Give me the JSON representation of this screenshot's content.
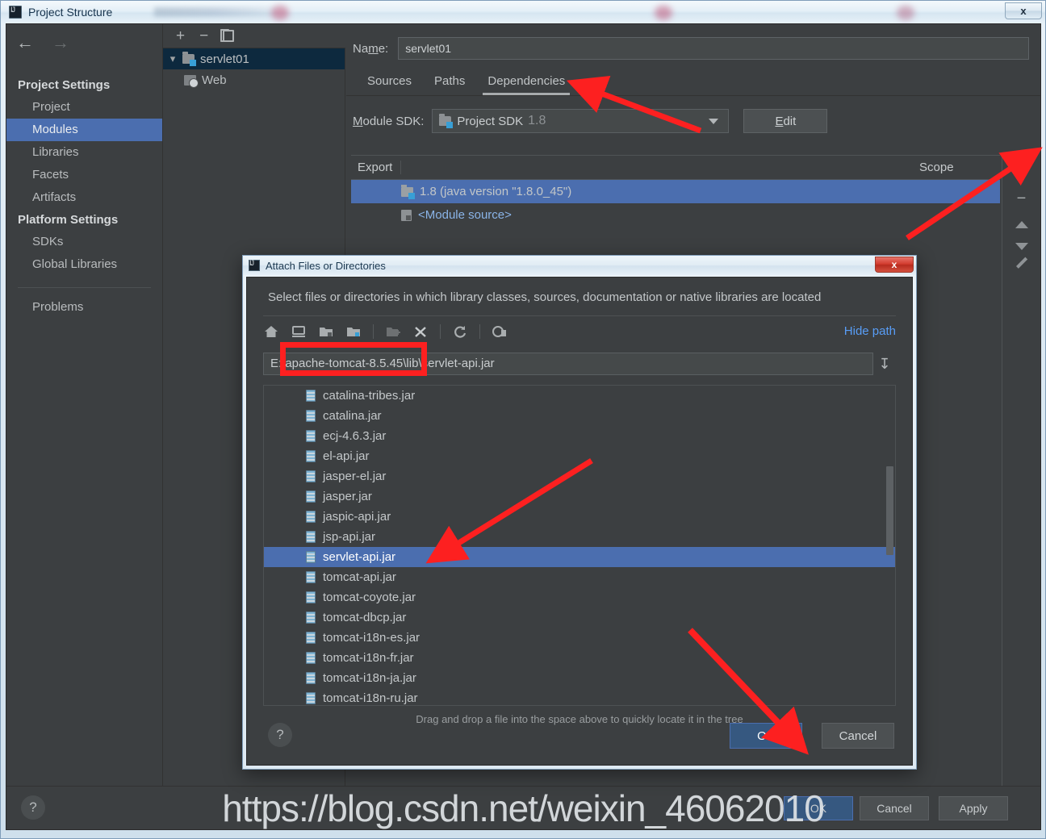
{
  "window": {
    "title": "Project Structure",
    "close_label": "x",
    "app_icon": "intellij-idea-icon"
  },
  "sidebar": {
    "back_icon": "back-arrow-icon",
    "forward_icon": "forward-arrow-icon",
    "groups": [
      {
        "title": "Project Settings",
        "items": [
          {
            "label": "Project",
            "selected": false
          },
          {
            "label": "Modules",
            "selected": true
          },
          {
            "label": "Libraries",
            "selected": false
          },
          {
            "label": "Facets",
            "selected": false
          },
          {
            "label": "Artifacts",
            "selected": false
          }
        ]
      },
      {
        "title": "Platform Settings",
        "items": [
          {
            "label": "SDKs",
            "selected": false
          },
          {
            "label": "Global Libraries",
            "selected": false
          }
        ]
      }
    ],
    "problems_label": "Problems"
  },
  "tree": {
    "toolbar": {
      "add": "+",
      "remove": "−",
      "copy_icon": "copy-icon"
    },
    "nodes": [
      {
        "label": "servlet01",
        "icon": "module-folder-icon",
        "selected": true,
        "expanded": true
      },
      {
        "label": "Web",
        "icon": "web-facet-icon",
        "selected": false
      }
    ]
  },
  "module": {
    "name_label": "Name:",
    "name_value": "servlet01",
    "tabs": [
      {
        "label": "Sources",
        "active": false
      },
      {
        "label": "Paths",
        "active": false
      },
      {
        "label": "Dependencies",
        "active": true
      }
    ],
    "sdk_label": "Module SDK:",
    "sdk_value": "Project SDK",
    "sdk_version": "1.8",
    "edit_button": "Edit",
    "table": {
      "col_export": "Export",
      "col_scope": "Scope",
      "rows": [
        {
          "label": "1.8 (java version \"1.8.0_45\")",
          "icon": "jdk-icon",
          "selected": true,
          "link": false
        },
        {
          "label": "<Module source>",
          "icon": "module-source-icon",
          "selected": false,
          "link": true
        }
      ]
    },
    "side_buttons": [
      {
        "name": "add-dependency-button",
        "glyph": "+"
      },
      {
        "name": "remove-dependency-button",
        "glyph": "−"
      },
      {
        "name": "move-up-button",
        "glyph": ""
      },
      {
        "name": "move-down-button",
        "glyph": ""
      },
      {
        "name": "edit-dependency-button",
        "glyph": ""
      }
    ]
  },
  "main_footer": {
    "help": "?",
    "ok": "OK",
    "cancel": "Cancel",
    "apply": "Apply"
  },
  "dialog": {
    "title": "Attach Files or Directories",
    "close_label": "x",
    "description": "Select files or directories in which library classes, sources, documentation or native libraries are located",
    "toolbar": [
      {
        "name": "home-icon",
        "glyph": "⌂",
        "disabled": false
      },
      {
        "name": "desktop-icon",
        "glyph": "⎕",
        "disabled": false
      },
      {
        "name": "project-folder-icon",
        "glyph": "▣",
        "disabled": false
      },
      {
        "name": "module-folder-icon",
        "glyph": "■",
        "disabled": false
      },
      {
        "name": "new-folder-icon",
        "glyph": "➕",
        "disabled": true
      },
      {
        "name": "delete-icon",
        "glyph": "✕",
        "disabled": false
      },
      {
        "name": "refresh-icon",
        "glyph": "⟳",
        "disabled": false
      },
      {
        "name": "show-hidden-files-icon",
        "glyph": "⊙",
        "disabled": false
      }
    ],
    "hide_path_label": "Hide path",
    "path_value": "E:\\apache-tomcat-8.5.45\\lib\\servlet-api.jar",
    "path_dropdown_icon": "path-history-icon",
    "files": [
      {
        "label": "catalina-tribes.jar",
        "selected": false
      },
      {
        "label": "catalina.jar",
        "selected": false
      },
      {
        "label": "ecj-4.6.3.jar",
        "selected": false
      },
      {
        "label": "el-api.jar",
        "selected": false
      },
      {
        "label": "jasper-el.jar",
        "selected": false
      },
      {
        "label": "jasper.jar",
        "selected": false
      },
      {
        "label": "jaspic-api.jar",
        "selected": false
      },
      {
        "label": "jsp-api.jar",
        "selected": false
      },
      {
        "label": "servlet-api.jar",
        "selected": true
      },
      {
        "label": "tomcat-api.jar",
        "selected": false
      },
      {
        "label": "tomcat-coyote.jar",
        "selected": false
      },
      {
        "label": "tomcat-dbcp.jar",
        "selected": false
      },
      {
        "label": "tomcat-i18n-es.jar",
        "selected": false
      },
      {
        "label": "tomcat-i18n-fr.jar",
        "selected": false
      },
      {
        "label": "tomcat-i18n-ja.jar",
        "selected": false
      },
      {
        "label": "tomcat-i18n-ru.jar",
        "selected": false
      }
    ],
    "drag_hint": "Drag and drop a file into the space above to quickly locate it in the tree",
    "help": "?",
    "ok": "OK",
    "cancel": "Cancel"
  },
  "annotations": {
    "watermark": "https://blog.csdn.net/weixin_46062010",
    "highlight_color": "#fd2020",
    "arrow_count": 4
  }
}
